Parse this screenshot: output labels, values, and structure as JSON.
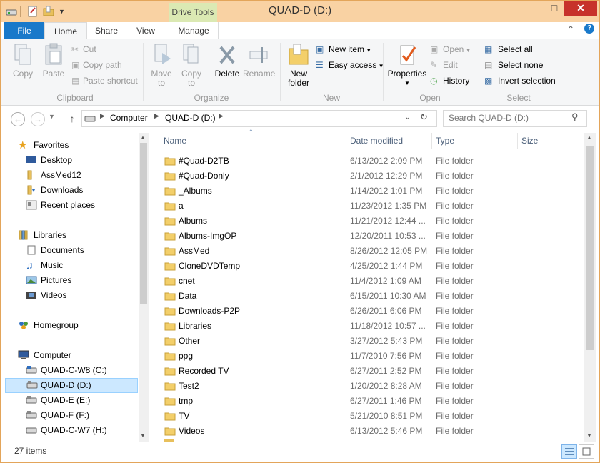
{
  "window": {
    "title": "QUAD-D (D:)",
    "context_tab": "Drive Tools"
  },
  "tabs": {
    "file": "File",
    "home": "Home",
    "share": "Share",
    "view": "View",
    "manage": "Manage"
  },
  "ribbon": {
    "clipboard": {
      "label": "Clipboard",
      "copy": "Copy",
      "paste": "Paste",
      "cut": "Cut",
      "copy_path": "Copy path",
      "paste_shortcut": "Paste shortcut"
    },
    "organize": {
      "label": "Organize",
      "move_to_1": "Move",
      "move_to_2": "to",
      "copy_to_1": "Copy",
      "copy_to_2": "to",
      "delete": "Delete",
      "rename": "Rename"
    },
    "new": {
      "label": "New",
      "new_folder_1": "New",
      "new_folder_2": "folder",
      "new_item": "New item",
      "easy_access": "Easy access"
    },
    "open": {
      "label": "Open",
      "properties": "Properties",
      "open": "Open",
      "edit": "Edit",
      "history": "History"
    },
    "select": {
      "label": "Select",
      "select_all": "Select all",
      "select_none": "Select none",
      "invert": "Invert selection"
    }
  },
  "address": {
    "crumbs": [
      "Computer",
      "QUAD-D (D:)"
    ],
    "search_placeholder": "Search QUAD-D (D:)"
  },
  "nav": {
    "favorites": "Favorites",
    "fav_items": [
      "Desktop",
      "AssMed12",
      "Downloads",
      "Recent places"
    ],
    "libraries": "Libraries",
    "lib_items": [
      "Documents",
      "Music",
      "Pictures",
      "Videos"
    ],
    "homegroup": "Homegroup",
    "computer": "Computer",
    "drives": [
      "QUAD-C-W8 (C:)",
      "QUAD-D (D:)",
      "QUAD-E (E:)",
      "QUAD-F (F:)",
      "QUAD-C-W7 (H:)"
    ]
  },
  "columns": {
    "name": "Name",
    "date": "Date modified",
    "type": "Type",
    "size": "Size"
  },
  "files": [
    {
      "name": "#Quad-D2TB",
      "date": "6/13/2012 2:09 PM",
      "type": "File folder"
    },
    {
      "name": "#Quad-Donly",
      "date": "2/1/2012 12:29 PM",
      "type": "File folder"
    },
    {
      "name": "_Albums",
      "date": "1/14/2012 1:01 PM",
      "type": "File folder"
    },
    {
      "name": "a",
      "date": "11/23/2012 1:35 PM",
      "type": "File folder"
    },
    {
      "name": "Albums",
      "date": "11/21/2012 12:44 ...",
      "type": "File folder"
    },
    {
      "name": "Albums-ImgOP",
      "date": "12/20/2011 10:53 ...",
      "type": "File folder"
    },
    {
      "name": "AssMed",
      "date": "8/26/2012 12:05 PM",
      "type": "File folder"
    },
    {
      "name": "CloneDVDTemp",
      "date": "4/25/2012 1:44 PM",
      "type": "File folder"
    },
    {
      "name": "cnet",
      "date": "11/4/2012 1:09 AM",
      "type": "File folder"
    },
    {
      "name": "Data",
      "date": "6/15/2011 10:30 AM",
      "type": "File folder"
    },
    {
      "name": "Downloads-P2P",
      "date": "6/26/2011 6:06 PM",
      "type": "File folder"
    },
    {
      "name": "Libraries",
      "date": "11/18/2012 10:57 ...",
      "type": "File folder"
    },
    {
      "name": "Other",
      "date": "3/27/2012 5:43 PM",
      "type": "File folder"
    },
    {
      "name": "ppg",
      "date": "11/7/2010 7:56 PM",
      "type": "File folder"
    },
    {
      "name": "Recorded TV",
      "date": "6/27/2011 2:52 PM",
      "type": "File folder"
    },
    {
      "name": "Test2",
      "date": "1/20/2012 8:28 AM",
      "type": "File folder"
    },
    {
      "name": "tmp",
      "date": "6/27/2011 1:46 PM",
      "type": "File folder"
    },
    {
      "name": "TV",
      "date": "5/21/2010 8:51 PM",
      "type": "File folder"
    },
    {
      "name": "Videos",
      "date": "6/13/2012 5:46 PM",
      "type": "File folder"
    }
  ],
  "status": {
    "items": "27 items"
  }
}
